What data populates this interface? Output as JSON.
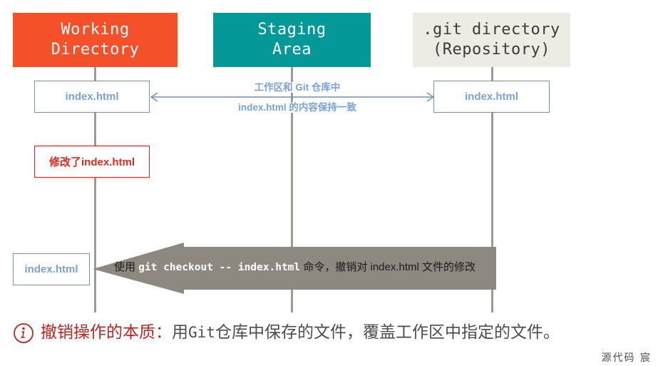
{
  "diagram": {
    "columns": [
      {
        "id": "working-directory",
        "title": "Working\nDirectory",
        "bg": "#f4502a",
        "fg": "#ffffff"
      },
      {
        "id": "staging-area",
        "title": "Staging\nArea",
        "bg": "#049898",
        "fg": "#ffffff"
      },
      {
        "id": "git-directory",
        "title": ".git directory\n(Repository)",
        "bg": "#edece4",
        "fg": "#3b3b38"
      }
    ],
    "boxes": {
      "working_index_top": "index.html",
      "git_index_top": "index.html",
      "working_modified": "修改了index.html",
      "working_index_bottom": "index.html"
    },
    "sync_note": {
      "line1": "工作区和 Git 仓库中",
      "line2_file": "index.html",
      "line2_rest": " 的内容保持一致"
    },
    "action_arrow": {
      "prefix": "使用 ",
      "command": "git checkout -- index.html",
      "suffix": " 命令，撤销对 index.html 文件的修改",
      "color": "#8d8880"
    }
  },
  "caption": {
    "icon": "info-icon",
    "highlight": "撤销操作的本质：",
    "rest_a": "用 ",
    "rest_mono": "Git",
    "rest_b": " 仓库中保存的文件，覆盖工作区中指定的文件。",
    "highlight_color": "#c0241f"
  },
  "watermark": {
    "text": "源代码  宸"
  }
}
